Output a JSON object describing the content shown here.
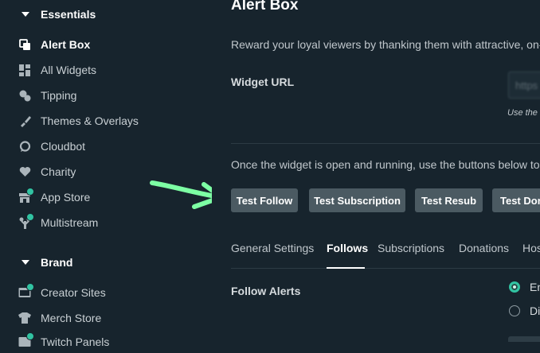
{
  "sidebar": {
    "sections": [
      {
        "label": "Essentials"
      },
      {
        "label": "Brand"
      }
    ],
    "items": [
      {
        "label": "Alert Box",
        "icon": "alert-box-icon"
      },
      {
        "label": "All Widgets",
        "icon": "widgets-grid-icon"
      },
      {
        "label": "Tipping",
        "icon": "coins-icon"
      },
      {
        "label": "Themes & Overlays",
        "icon": "paint-brush-icon"
      },
      {
        "label": "Cloudbot",
        "icon": "chat-bubble-icon"
      },
      {
        "label": "Charity",
        "icon": "heart-icon"
      },
      {
        "label": "App Store",
        "icon": "store-icon"
      },
      {
        "label": "Multistream",
        "icon": "multistream-icon"
      },
      {
        "label": "Creator Sites",
        "icon": "browser-window-icon"
      },
      {
        "label": "Merch Store",
        "icon": "tshirt-icon"
      },
      {
        "label": "Twitch Panels",
        "icon": "panels-icon"
      }
    ]
  },
  "main": {
    "title": "Alert Box",
    "description": "Reward your loyal viewers by thanking them with attractive, on-",
    "widget_url_label": "Widget URL",
    "widget_url_value": "https",
    "widget_url_hint": "Use the",
    "instructions": "Once the widget is open and running, use the buttons below to",
    "test_buttons": [
      "Test Follow",
      "Test Subscription",
      "Test Resub",
      "Test Don"
    ],
    "tabs": [
      "General Settings",
      "Follows",
      "Subscriptions",
      "Donations",
      "Hos"
    ],
    "active_tab": "Follows",
    "follow_alerts_label": "Follow Alerts",
    "radio_options": [
      {
        "label": "En",
        "selected": true
      },
      {
        "label": "Di",
        "selected": false
      }
    ]
  },
  "colors": {
    "background": "#17242d",
    "accent": "#31c3a2",
    "button": "#4b5a62",
    "annotation_arrow": "#7dffa4"
  }
}
